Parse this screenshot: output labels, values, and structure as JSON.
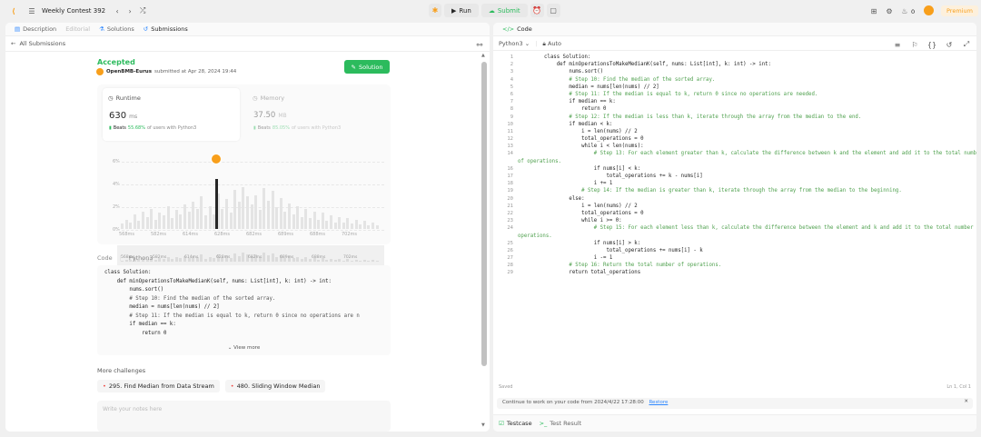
{
  "topbar": {
    "title": "Weekly Contest 392",
    "run": "Run",
    "submit": "Submit",
    "streak": "0",
    "premium": "Premium"
  },
  "left_tabs": [
    "Description",
    "Editorial",
    "Solutions",
    "Submissions"
  ],
  "back_label": "All Submissions",
  "submission": {
    "status": "Accepted",
    "user": "OpenBMB-Eurus",
    "submitted": "submitted at Apr 28, 2024 19:44",
    "solution_btn": "Solution"
  },
  "runtime": {
    "label": "Runtime",
    "value": "630",
    "unit": "ms",
    "beats": "Beats",
    "pct": "55.68%",
    "suffix": "of users with Python3"
  },
  "memory": {
    "label": "Memory",
    "value": "37.50",
    "unit": "MB",
    "beats": "Beats",
    "pct": "85.05%",
    "suffix": "of users with Python3"
  },
  "chart_data": {
    "type": "bar",
    "y_ticks": [
      "6%",
      "4%",
      "2%",
      "0%"
    ],
    "x_ticks": [
      "568ms",
      "582ms",
      "614ms",
      "628ms",
      "682ms",
      "689ms",
      "688ms",
      "702ms"
    ],
    "ylim": [
      0,
      6
    ]
  },
  "code_preview": {
    "label": "Code",
    "lang": "Python3",
    "view_more": "View more"
  },
  "challenges": {
    "label": "More challenges",
    "items": [
      "295. Find Median from Data Stream",
      "480. Sliding Window Median"
    ]
  },
  "notes_placeholder": "Write your notes here",
  "editor": {
    "tab": "Code",
    "lang": "Python3",
    "auto": "Auto",
    "saved": "Saved",
    "cursor": "Ln 1, Col 1",
    "notice": "Continue to work on your code from 2024/4/22 17:28:00",
    "restore": "Restore",
    "testcase": "Testcase",
    "test_result": "Test Result"
  },
  "code_lines": [
    "class Solution:",
    "    def minOperationsToMakeMedianK(self, nums: List[int], k: int) -> int:",
    "        nums.sort()",
    "        # Step 10: Find the median of the sorted array.",
    "        median = nums[len(nums) // 2]",
    "        # Step 11: If the median is equal to k, return 0 since no operations are needed.",
    "        if median == k:",
    "            return 0",
    "        # Step 12: If the median is less than k, iterate through the array from the median to the end.",
    "        if median < k:",
    "            i = len(nums) // 2",
    "            total_operations = 0",
    "            while i < len(nums):",
    "                # Step 13: For each element greater than k, calculate the difference between k and the element and add it to the total number",
    "of operations.",
    "                if nums[i] < k:",
    "                    total_operations += k - nums[i]",
    "                i += 1",
    "            # Step 14: If the median is greater than k, iterate through the array from the median to the beginning.",
    "        else:",
    "            i = len(nums) // 2",
    "            total_operations = 0",
    "            while i >= 0:",
    "                # Step 15: For each element less than k, calculate the difference between the element and k and add it to the total number of",
    "operations.",
    "                if nums[i] > k:",
    "                    total_operations += nums[i] - k",
    "                i -= 1",
    "        # Step 16: Return the total number of operations.",
    "        return total_operations"
  ],
  "line_numbers": [
    "1",
    "2",
    "3",
    "4",
    "5",
    "6",
    "7",
    "8",
    "9",
    "10",
    "11",
    "12",
    "13",
    "14",
    "",
    "16",
    "17",
    "18",
    "19",
    "20",
    "21",
    "22",
    "23",
    "24",
    "",
    "25",
    "26",
    "27",
    "28",
    "29"
  ],
  "preview_lines": [
    "class Solution:",
    "    def minOperationsToMakeMedianK(self, nums: List[int], k: int) -> int:",
    "        nums.sort()",
    "        # Step 10: Find the median of the sorted array.",
    "        median = nums[len(nums) // 2]",
    "        # Step 11: If the median is equal to k, return 0 since no operations are n",
    "        if median == k:",
    "            return 0"
  ]
}
